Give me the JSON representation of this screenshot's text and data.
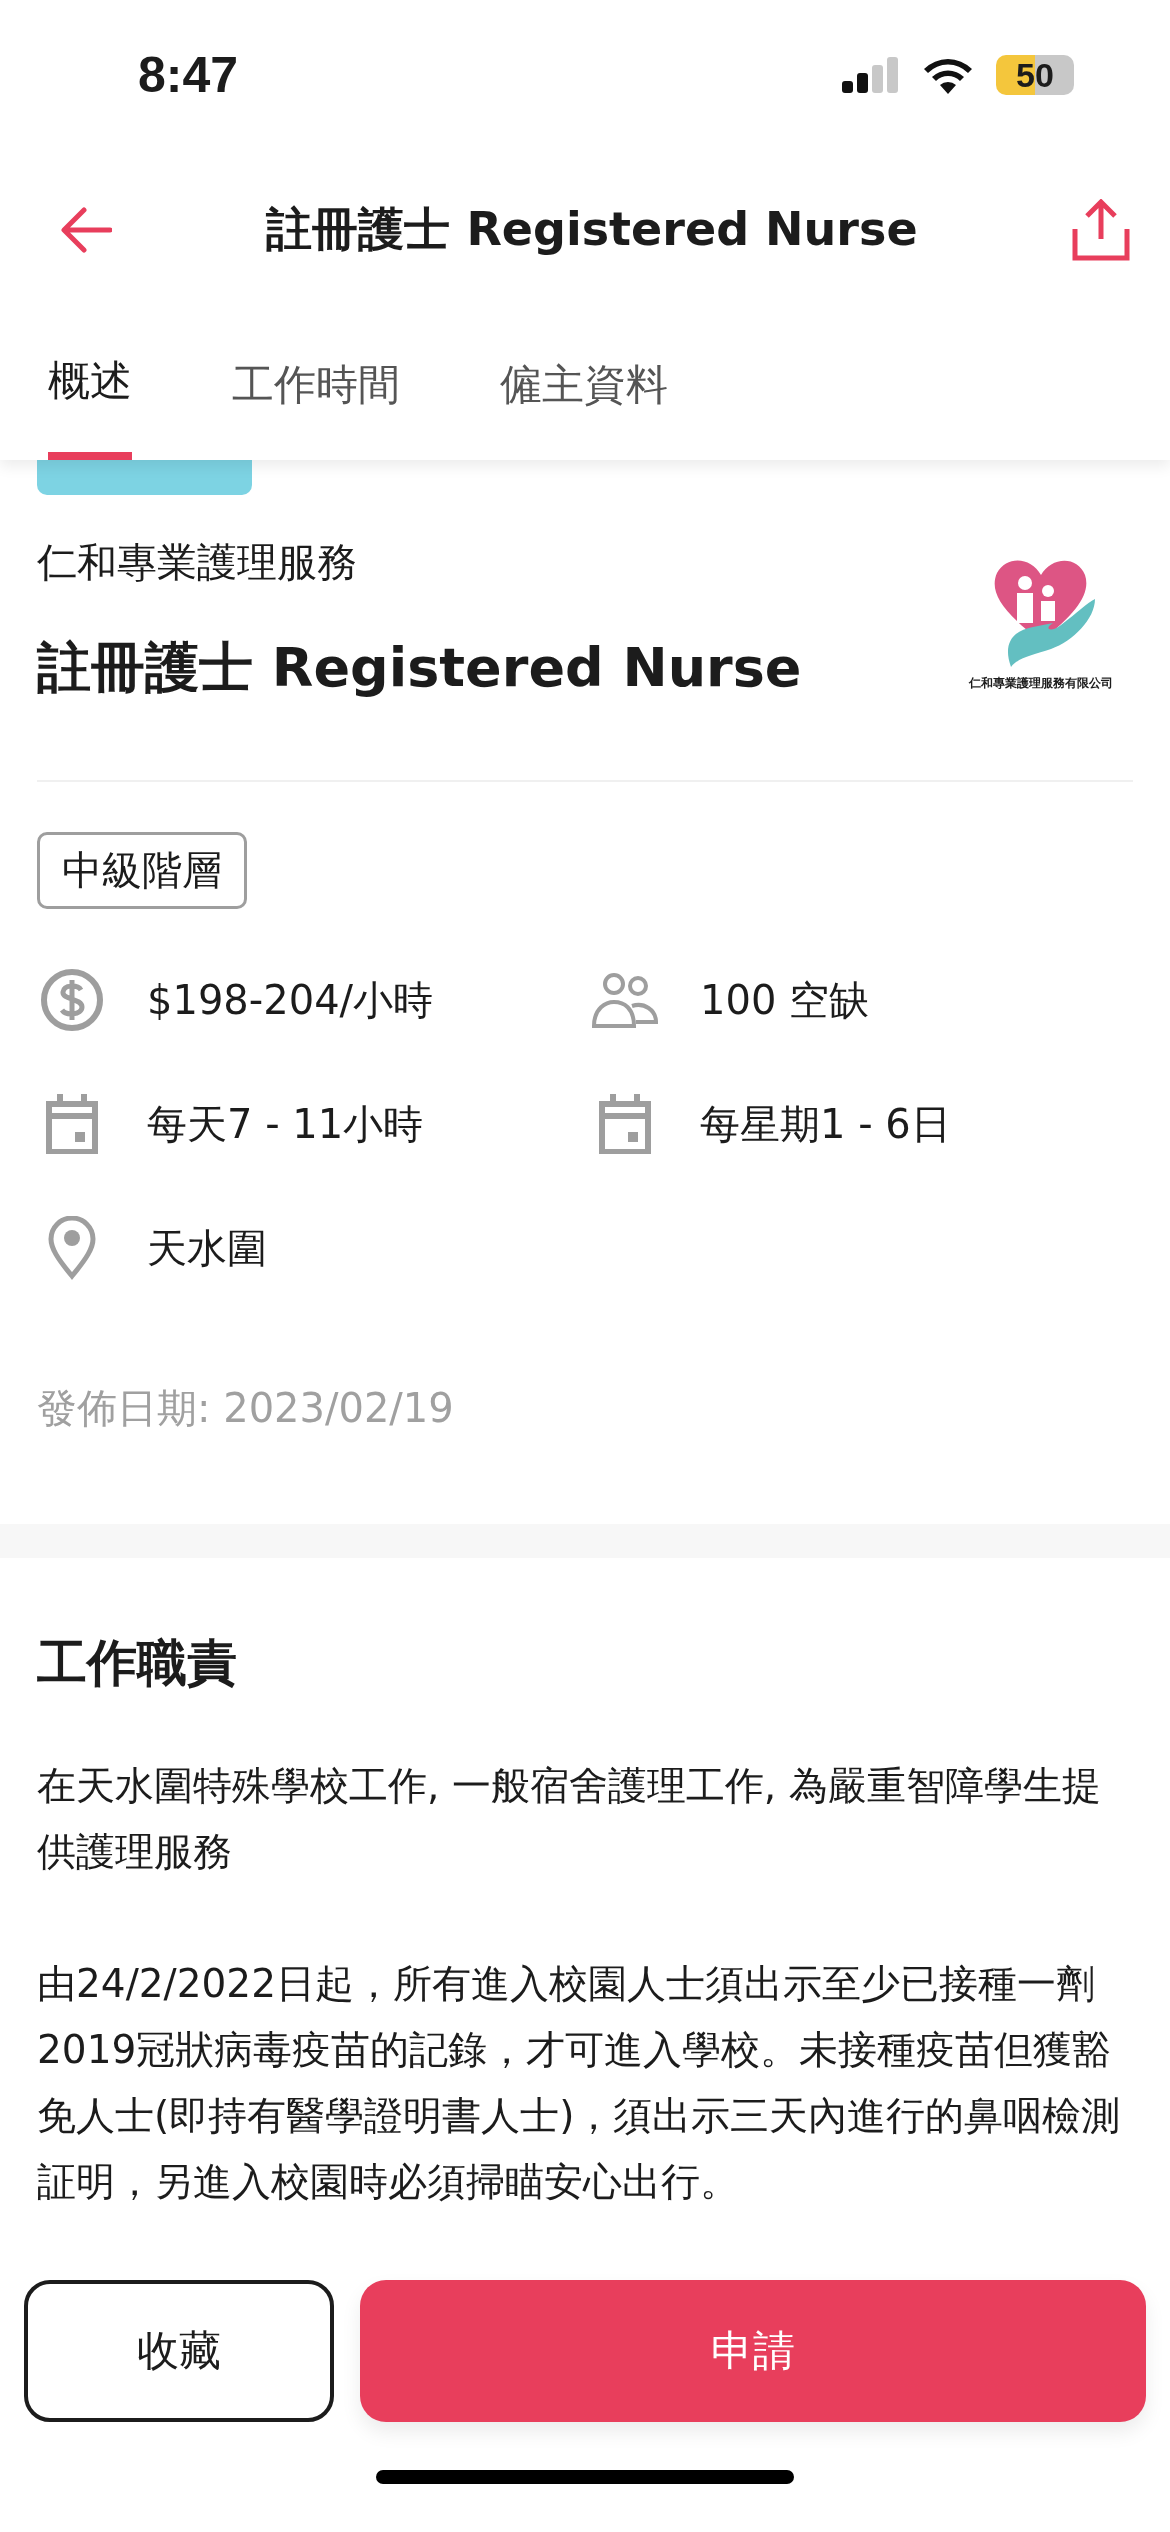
{
  "status_bar": {
    "time": "8:47",
    "battery": "50"
  },
  "header": {
    "title": "註冊護士 Registered Nurse"
  },
  "tabs": [
    {
      "label": "概述",
      "selected": true
    },
    {
      "label": "工作時間",
      "selected": false
    },
    {
      "label": "僱主資料",
      "selected": false
    }
  ],
  "job": {
    "employment_tag": {
      "color": "#7dd3e3"
    },
    "company": "仁和專業護理服務",
    "title": "註冊護士 Registered Nurse",
    "logo_caption": "仁和專業護理服務有限公司",
    "level_tag": "中級階層",
    "details": [
      {
        "kind": "salary",
        "text": "$198-204/小時"
      },
      {
        "kind": "vacancies",
        "text": "100 空缺"
      },
      {
        "kind": "hours",
        "text": "每天7 - 11小時"
      },
      {
        "kind": "days",
        "text": "每星期1 - 6日"
      },
      {
        "kind": "location",
        "text": "天水圍"
      }
    ],
    "posted": "發佈日期: 2023/02/19"
  },
  "duties": {
    "heading": "工作職責",
    "paragraphs": [
      "在天水圍特殊學校工作, 一般宿舍護理工作, 為嚴重智障學生提供護理服務",
      "由24/2/2022日起，所有進入校園人士須出示至少已接種一劑2019冠狀病毒疫苗的記錄，才可進入學校。未接種疫苗但獲豁免人士(即持有醫學證明書人士)，須出示三天內進行的鼻咽檢測証明，另進入校園時必須掃瞄安心出行。"
    ]
  },
  "actions": [
    {
      "kind": "secondary",
      "label": "收藏"
    },
    {
      "kind": "primary",
      "label": "申請"
    }
  ]
}
